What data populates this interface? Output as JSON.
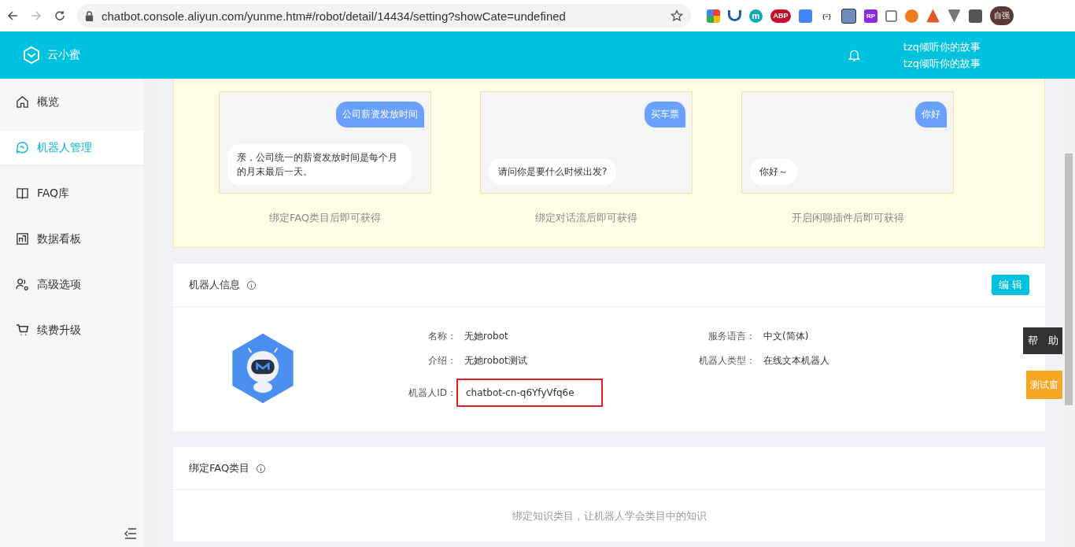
{
  "browser": {
    "url": "chatbot.console.aliyun.com/yunme.htm#/robot/detail/14434/setting?showCate=undefined",
    "extensions": [
      {
        "kind": "color"
      },
      {
        "kind": "v"
      },
      {
        "kind": "m",
        "text": "m"
      },
      {
        "kind": "abp",
        "text": "ABP"
      },
      {
        "kind": "translate"
      },
      {
        "kind": "braces",
        "text": "{≡}"
      },
      {
        "kind": "star"
      },
      {
        "kind": "rp",
        "text": "RP"
      },
      {
        "kind": "square"
      },
      {
        "kind": "ring"
      },
      {
        "kind": "tree"
      },
      {
        "kind": "vue"
      },
      {
        "kind": "puzzle"
      }
    ],
    "avatar": "自强"
  },
  "header": {
    "logo": "云小蜜",
    "users": [
      "tzq倾听你的故事",
      "tzq倾听你的故事"
    ]
  },
  "sidebar": {
    "items": [
      {
        "label": "概览",
        "selected": false
      },
      {
        "label": "机器人管理",
        "selected": true
      },
      {
        "label": "FAQ库",
        "selected": false
      },
      {
        "label": "数据看板",
        "selected": false
      },
      {
        "label": "高级选项",
        "selected": false
      },
      {
        "label": "续费升级",
        "selected": false
      }
    ]
  },
  "demos": [
    {
      "question": "公司薪资发放时间",
      "answer": "亲，公司统一的薪资发放时间是每个月的月末最后一天。",
      "hint": "绑定FAQ类目后即可获得"
    },
    {
      "question": "买车票",
      "answer": "请问你是要什么时候出发?",
      "hint": "绑定对话流后即可获得"
    },
    {
      "question": "你好",
      "answer": "你好～",
      "hint": "开启闲聊插件后即可获得"
    }
  ],
  "robot_info": {
    "title": "机器人信息",
    "edit": "编 辑",
    "fields": [
      {
        "label": "名称：",
        "value": "无她robot",
        "highlighted": false
      },
      {
        "label": "服务语言：",
        "value": "中文(简体)",
        "highlighted": false
      },
      {
        "label": "介绍：",
        "value": "无她robot测试",
        "highlighted": false
      },
      {
        "label": "机器人类型：",
        "value": "在线文本机器人",
        "highlighted": false
      },
      {
        "label": "机器人ID：",
        "value": "chatbot-cn-q6YfyVfq6e",
        "highlighted": true
      }
    ]
  },
  "faq_section": {
    "title": "绑定FAQ类目",
    "hint": "绑定知识类目，让机器人学会类目中的知识"
  },
  "floating": {
    "help": "帮　助",
    "test": "测试窗"
  }
}
